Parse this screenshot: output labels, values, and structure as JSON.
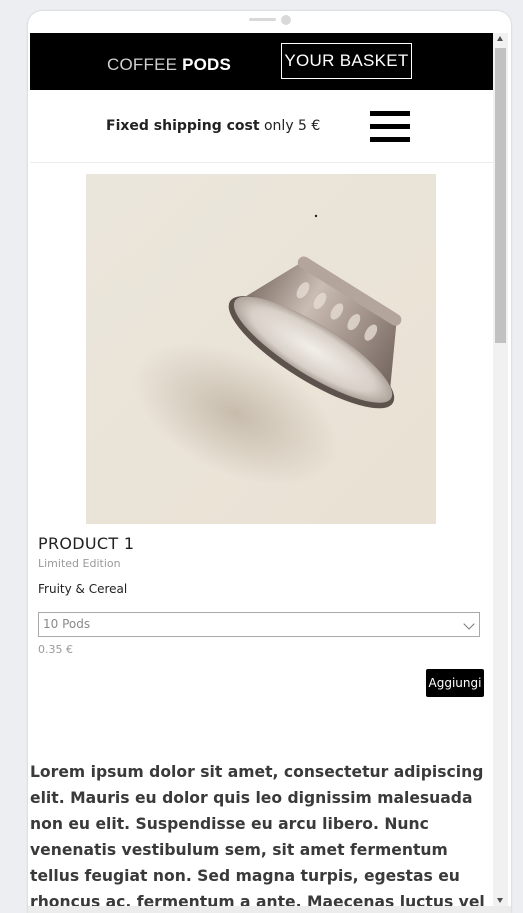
{
  "header": {
    "logo_light": "COFFEE",
    "logo_bold": "PODS",
    "basket_label": "YOUR BASKET"
  },
  "shipping": {
    "bold_text": "Fixed shipping cost",
    "rest_text": "only 5 €"
  },
  "product": {
    "title": "PRODUCT 1",
    "edition": "Limited Edition",
    "flavor": "Fruity & Cereal",
    "select_value": "10 Pods",
    "price": "0.35 €",
    "add_label": "Aggiungi"
  },
  "body_text": "Lorem ipsum dolor sit amet, consectetur adipiscing elit. Mauris eu dolor quis leo dignissim malesuada non eu elit. Suspendisse eu arcu libero. Nunc venenatis vestibulum sem, sit amet fermentum tellus feugiat non. Sed magna turpis, egestas eu rhoncus ac, fermentum a ante. Maecenas luctus vel nibh a tincidunt.",
  "icons": {
    "menu": "hamburger-menu-icon",
    "dropdown": "chevron-down-icon"
  },
  "colors": {
    "header_bg": "#000000",
    "button_bg": "#000000",
    "text_muted": "#9a9a9a"
  }
}
